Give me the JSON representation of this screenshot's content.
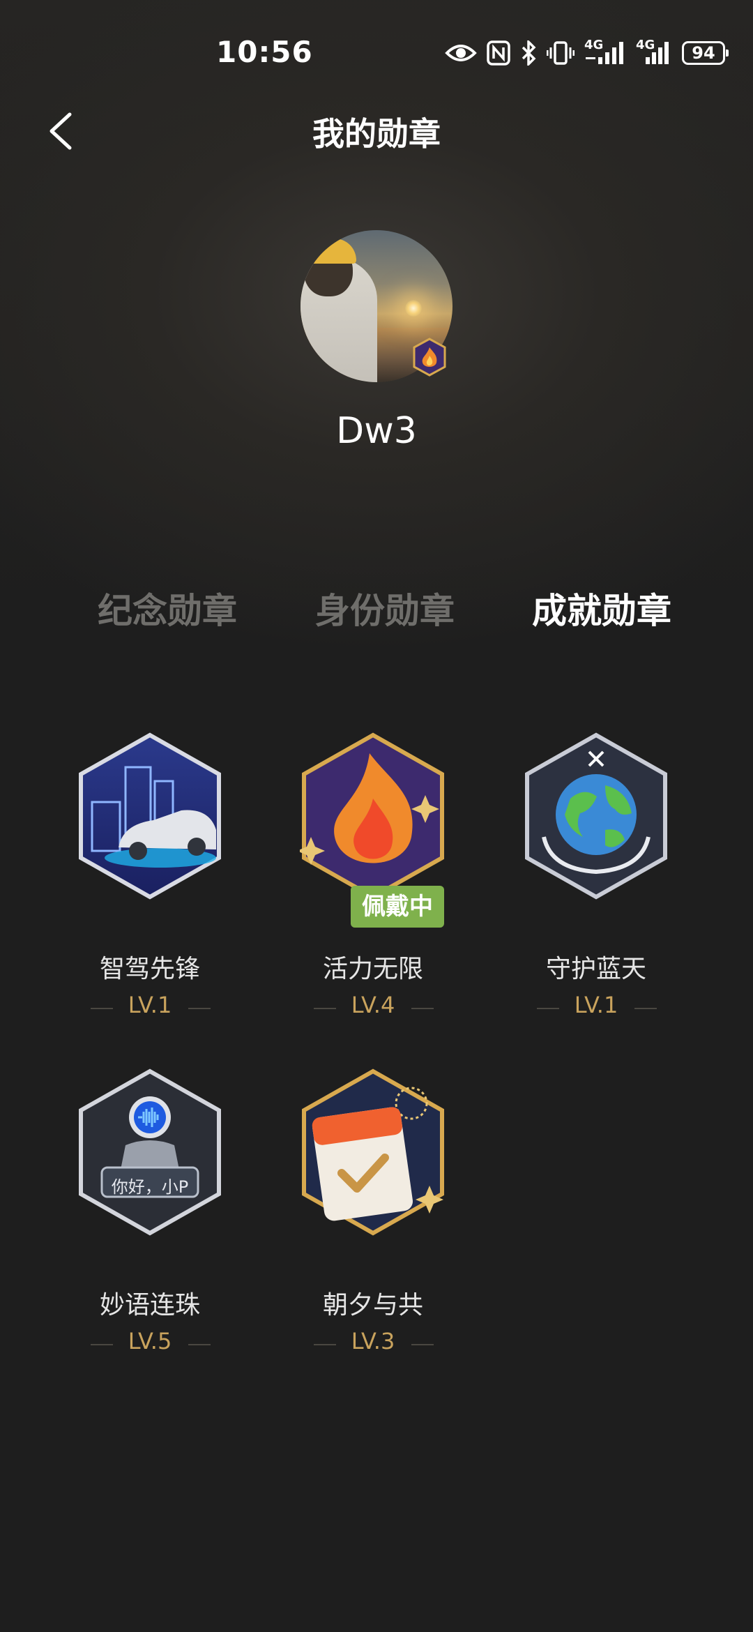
{
  "status_bar": {
    "time": "10:56",
    "network_1": "4G",
    "network_2": "4G",
    "battery": "94",
    "icons": [
      "eye-icon",
      "nfc-icon",
      "bluetooth-icon",
      "vibrate-icon",
      "signal-icon",
      "signal-icon",
      "battery-icon"
    ]
  },
  "header": {
    "back_icon": "chevron-left-icon",
    "title": "我的勋章"
  },
  "profile": {
    "username": "Dw3",
    "badge_icon": "flame-badge-icon"
  },
  "tabs": [
    {
      "label": "纪念勋章",
      "active": false
    },
    {
      "label": "身份勋章",
      "active": false
    },
    {
      "label": "成就勋章",
      "active": true
    }
  ],
  "badges": [
    {
      "name": "智驾先锋",
      "level": "LV.1",
      "icon": "car-city-icon",
      "wearing": false
    },
    {
      "name": "活力无限",
      "level": "LV.4",
      "icon": "flame-icon",
      "wearing": true,
      "wearing_label": "佩戴中"
    },
    {
      "name": "守护蓝天",
      "level": "LV.1",
      "icon": "earth-hands-icon",
      "wearing": false
    },
    {
      "name": "妙语连珠",
      "level": "LV.5",
      "icon": "robot-voice-icon",
      "wearing": false,
      "art_text": "你好，小P"
    },
    {
      "name": "朝夕与共",
      "level": "LV.3",
      "icon": "calendar-check-icon",
      "wearing": false
    }
  ],
  "colors": {
    "background": "#1e1e1e",
    "tab_inactive": "#6f6e6b",
    "level_gold": "#c9a35d",
    "wearing_green": "#7fb14c"
  }
}
